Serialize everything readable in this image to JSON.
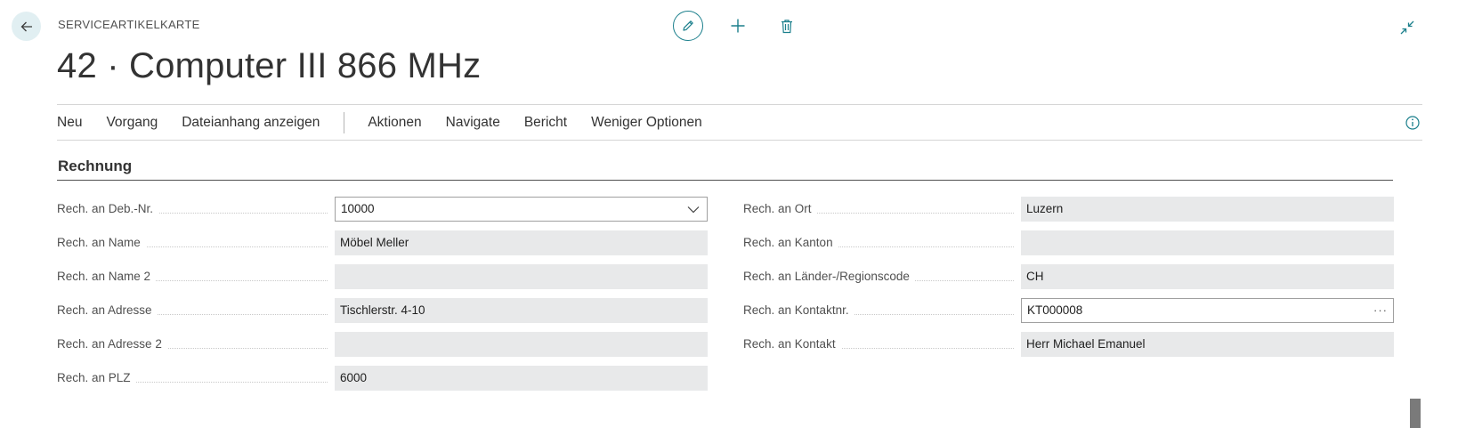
{
  "header": {
    "caption": "SERVICEARTIKELKARTE",
    "title": "42 · Computer III 866 MHz"
  },
  "icons": {
    "back": "arrow-left-icon",
    "edit": "pencil-icon",
    "add": "plus-icon",
    "delete": "trash-icon",
    "collapse": "collapse-icon",
    "info": "info-icon"
  },
  "actions": {
    "items_before": [
      "Neu",
      "Vorgang",
      "Dateianhang anzeigen"
    ],
    "items_after": [
      "Aktionen",
      "Navigate",
      "Bericht",
      "Weniger Optionen"
    ]
  },
  "section": {
    "title": "Rechnung"
  },
  "fields_left": [
    {
      "label": "Rech. an Deb.-Nr.",
      "value": "10000",
      "editable": true,
      "control": "dropdown"
    },
    {
      "label": "Rech. an Name",
      "value": "Möbel Meller",
      "editable": false
    },
    {
      "label": "Rech. an Name 2",
      "value": "",
      "editable": false
    },
    {
      "label": "Rech. an Adresse",
      "value": "Tischlerstr. 4-10",
      "editable": false
    },
    {
      "label": "Rech. an Adresse 2",
      "value": "",
      "editable": false
    },
    {
      "label": "Rech. an PLZ",
      "value": "6000",
      "editable": false
    }
  ],
  "fields_right": [
    {
      "label": "Rech. an Ort",
      "value": "Luzern",
      "editable": false
    },
    {
      "label": "Rech. an Kanton",
      "value": "",
      "editable": false
    },
    {
      "label": "Rech. an Länder-/Regionscode",
      "value": "CH",
      "editable": false
    },
    {
      "label": "Rech. an Kontaktnr.",
      "value": "KT000008",
      "editable": true,
      "control": "lookup"
    },
    {
      "label": "Rech. an Kontakt",
      "value": "Herr Michael Emanuel",
      "editable": false
    }
  ],
  "colors": {
    "accent": "#1b7f8c",
    "readonly_field": "#e8e9ea",
    "back_button_bg": "#e1eff2"
  }
}
